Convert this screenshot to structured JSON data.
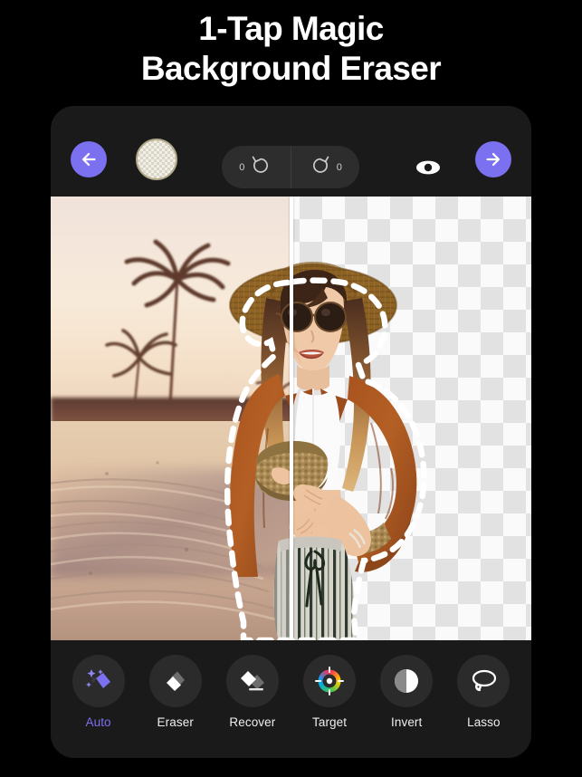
{
  "headline": {
    "line1": "1-Tap Magic",
    "line2": "Background Eraser"
  },
  "app": {
    "topbar": {
      "back_icon": "arrow-left-icon",
      "forward_icon": "arrow-right-icon",
      "swatch_label": "transparent-swatch",
      "undo_count": "0",
      "redo_count": "0",
      "undo_icon": "undo-icon",
      "redo_icon": "redo-icon",
      "preview_icon": "eye-icon"
    },
    "canvas": {
      "mode": "before-after-split",
      "left_label": "original-photo",
      "right_label": "transparent-checkerboard",
      "selection_outline": "marching-ants-dashed"
    },
    "tools": [
      {
        "label": "Auto",
        "icon": "magic-eraser-icon",
        "active": true
      },
      {
        "label": "Eraser",
        "icon": "eraser-icon",
        "active": false
      },
      {
        "label": "Recover",
        "icon": "recover-icon",
        "active": false
      },
      {
        "label": "Target",
        "icon": "color-wheel-icon",
        "active": false
      },
      {
        "label": "Invert",
        "icon": "invert-icon",
        "active": false
      },
      {
        "label": "Lasso",
        "icon": "lasso-icon",
        "active": false
      }
    ]
  },
  "colors": {
    "background": "#000000",
    "frame": "#1a1a1a",
    "accent": "#7b70f0",
    "tool_circle": "#2b2b2b",
    "pill": "#2d2d2d",
    "checker_light": "#fafafa",
    "checker_dark": "#e2e2e2"
  }
}
